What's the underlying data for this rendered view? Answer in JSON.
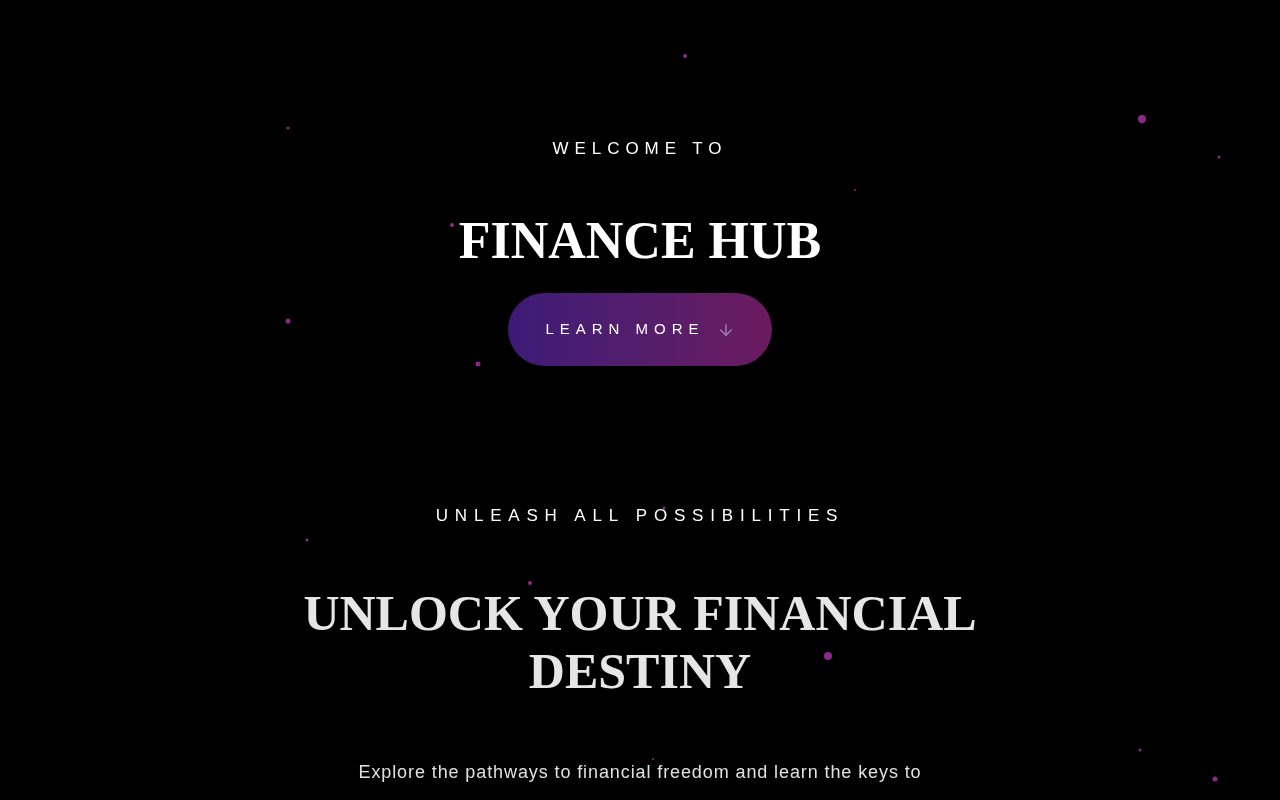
{
  "hero": {
    "eyebrow": "WELCOME TO",
    "title": "FINANCE HUB",
    "button": {
      "label": "LEARN MORE"
    }
  },
  "section": {
    "eyebrow": "UNLEASH ALL POSSIBILITIES",
    "title": "UNLOCK YOUR FINANCIAL DESTINY",
    "text": "Explore the pathways to financial freedom and learn the keys to"
  }
}
